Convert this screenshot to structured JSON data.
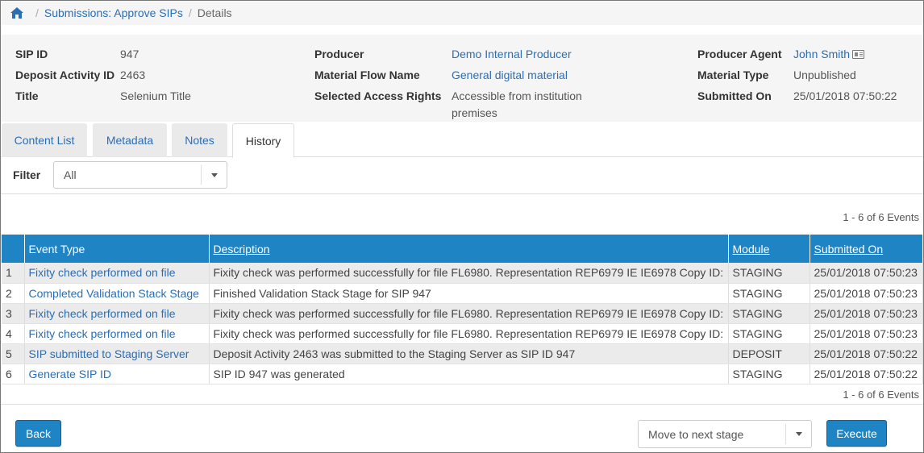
{
  "breadcrumb": {
    "parent": "Submissions: Approve SIPs",
    "current": "Details"
  },
  "summary": {
    "sip_id_label": "SIP ID",
    "sip_id": "947",
    "deposit_activity_label": "Deposit Activity ID",
    "deposit_activity_id": "2463",
    "title_label": "Title",
    "title": "Selenium Title",
    "producer_label": "Producer",
    "producer": "Demo Internal Producer",
    "material_flow_label": "Material Flow Name",
    "material_flow": "General digital material",
    "access_rights_label": "Selected Access Rights",
    "access_rights_line1": "Accessible from institution",
    "access_rights_line2": "premises",
    "producer_agent_label": "Producer Agent",
    "producer_agent": "John Smith",
    "material_type_label": "Material Type",
    "material_type": "Unpublished",
    "submitted_on_label": "Submitted On",
    "submitted_on": "25/01/2018 07:50:22"
  },
  "tabs": [
    {
      "label": "Content List"
    },
    {
      "label": "Metadata"
    },
    {
      "label": "Notes"
    },
    {
      "label": "History",
      "active": true
    }
  ],
  "filter": {
    "label": "Filter",
    "value": "All"
  },
  "pagination": {
    "top": "1 - 6 of 6 Events",
    "bottom": "1 - 6 of 6 Events"
  },
  "table": {
    "headers": [
      "Event Type",
      "Description",
      "Module",
      "Submitted On"
    ],
    "rows": [
      {
        "num": "1",
        "event_type": "Fixity check performed on file",
        "description": "Fixity check was performed successfully for file FL6980. Representation REP6979 IE IE6978 Copy ID:",
        "module": "STAGING",
        "submitted_on": "25/01/2018 07:50:23"
      },
      {
        "num": "2",
        "event_type": "Completed Validation Stack Stage",
        "description": "Finished Validation Stack Stage for SIP 947",
        "module": "STAGING",
        "submitted_on": "25/01/2018 07:50:23"
      },
      {
        "num": "3",
        "event_type": "Fixity check performed on file",
        "description": "Fixity check was performed successfully for file FL6980. Representation REP6979 IE IE6978 Copy ID:",
        "module": "STAGING",
        "submitted_on": "25/01/2018 07:50:23"
      },
      {
        "num": "4",
        "event_type": "Fixity check performed on file",
        "description": "Fixity check was performed successfully for file FL6980. Representation REP6979 IE IE6978 Copy ID:",
        "module": "STAGING",
        "submitted_on": "25/01/2018 07:50:23"
      },
      {
        "num": "5",
        "event_type": "SIP submitted to Staging Server",
        "description": "Deposit Activity 2463 was submitted to the Staging Server as SIP ID 947",
        "module": "DEPOSIT",
        "submitted_on": "25/01/2018 07:50:22"
      },
      {
        "num": "6",
        "event_type": "Generate SIP ID",
        "description": "SIP ID 947 was generated",
        "module": "STAGING",
        "submitted_on": "25/01/2018 07:50:22"
      }
    ]
  },
  "footer": {
    "back_label": "Back",
    "stage_select_value": "Move to next stage",
    "execute_label": "Execute"
  },
  "colors": {
    "accent": "#1f84c4",
    "link": "#2a6eb5"
  }
}
